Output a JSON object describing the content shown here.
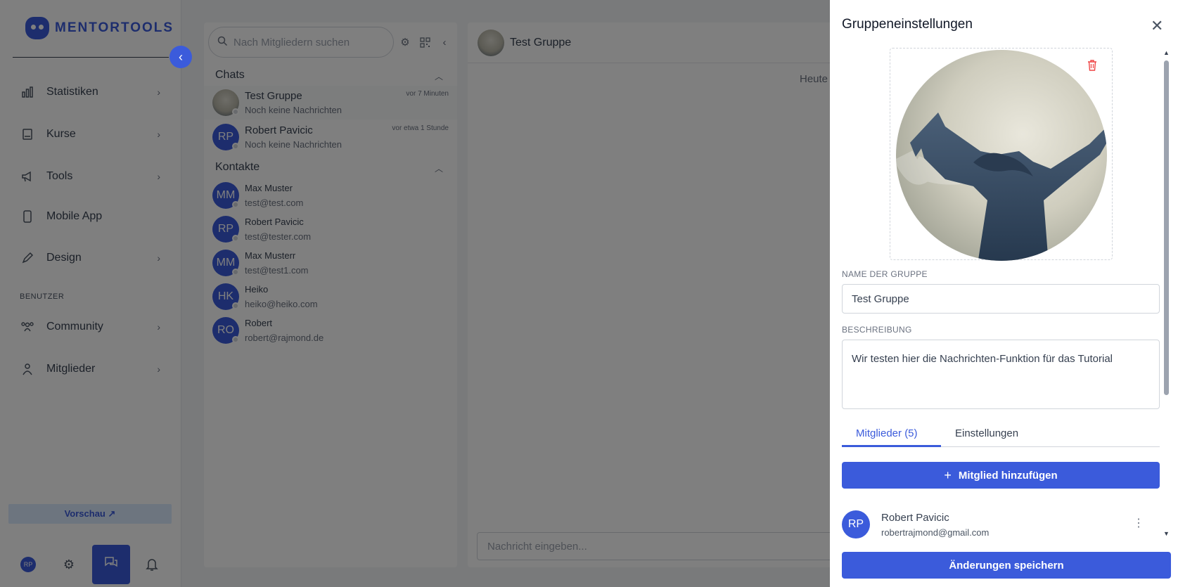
{
  "brand": {
    "name": "MENTORTOOLS"
  },
  "sidebar": {
    "collapse_icon": "‹",
    "items": [
      {
        "label": "Statistiken",
        "icon": "chart-icon"
      },
      {
        "label": "Kurse",
        "icon": "book-icon"
      },
      {
        "label": "Tools",
        "icon": "megaphone-icon"
      },
      {
        "label": "Mobile App",
        "icon": "phone-icon"
      },
      {
        "label": "Design",
        "icon": "pencil-icon"
      }
    ],
    "section_label": "BENUTZER",
    "user_items": [
      {
        "label": "Community",
        "icon": "community-icon"
      },
      {
        "label": "Mitglieder",
        "icon": "person-icon"
      }
    ],
    "preview_label": "Vorschau ↗",
    "user_initials": "RP"
  },
  "chatlist": {
    "search_placeholder": "Nach Mitgliedern suchen",
    "chats_heading": "Chats",
    "contacts_heading": "Kontakte",
    "chats": [
      {
        "name": "Test Gruppe",
        "subtitle": "Noch keine Nachrichten",
        "time": "vor 7 Minuten"
      },
      {
        "name": "Robert Pavicic",
        "initials": "RP",
        "subtitle": "Noch keine Nachrichten",
        "time": "vor etwa 1 Stunde"
      }
    ],
    "contacts": [
      {
        "initials": "MM",
        "name": "Max Muster",
        "email": "test@test.com"
      },
      {
        "initials": "RP",
        "name": "Robert Pavicic",
        "email": "test@tester.com"
      },
      {
        "initials": "MM",
        "name": "Max Musterr",
        "email": "test@test1.com"
      },
      {
        "initials": "HK",
        "name": "Heiko",
        "email": "heiko@heiko.com"
      },
      {
        "initials": "RO",
        "name": "Robert",
        "email": "robert@rajmond.de"
      }
    ]
  },
  "chat": {
    "title": "Test Gruppe",
    "today_label": "Heute",
    "input_placeholder": "Nachricht eingeben..."
  },
  "drawer": {
    "title": "Gruppeneinstellungen",
    "close_icon": "✕",
    "name_label": "NAME DER GRUPPE",
    "name_value": "Test Gruppe",
    "description_label": "BESCHREIBUNG",
    "description_value": "Wir testen hier die Nachrichten-Funktion für das Tutorial",
    "tabs": [
      {
        "label": "Mitglieder (5)",
        "active": true
      },
      {
        "label": "Einstellungen",
        "active": false
      }
    ],
    "add_member_label": "Mitglied hinzufügen",
    "members": [
      {
        "initials": "RP",
        "name": "Robert Pavicic",
        "email": "robertrajmond@gmail.com"
      }
    ],
    "save_label": "Änderungen speichern"
  },
  "colors": {
    "accent": "#3b5bdb",
    "danger": "#ef4444"
  }
}
